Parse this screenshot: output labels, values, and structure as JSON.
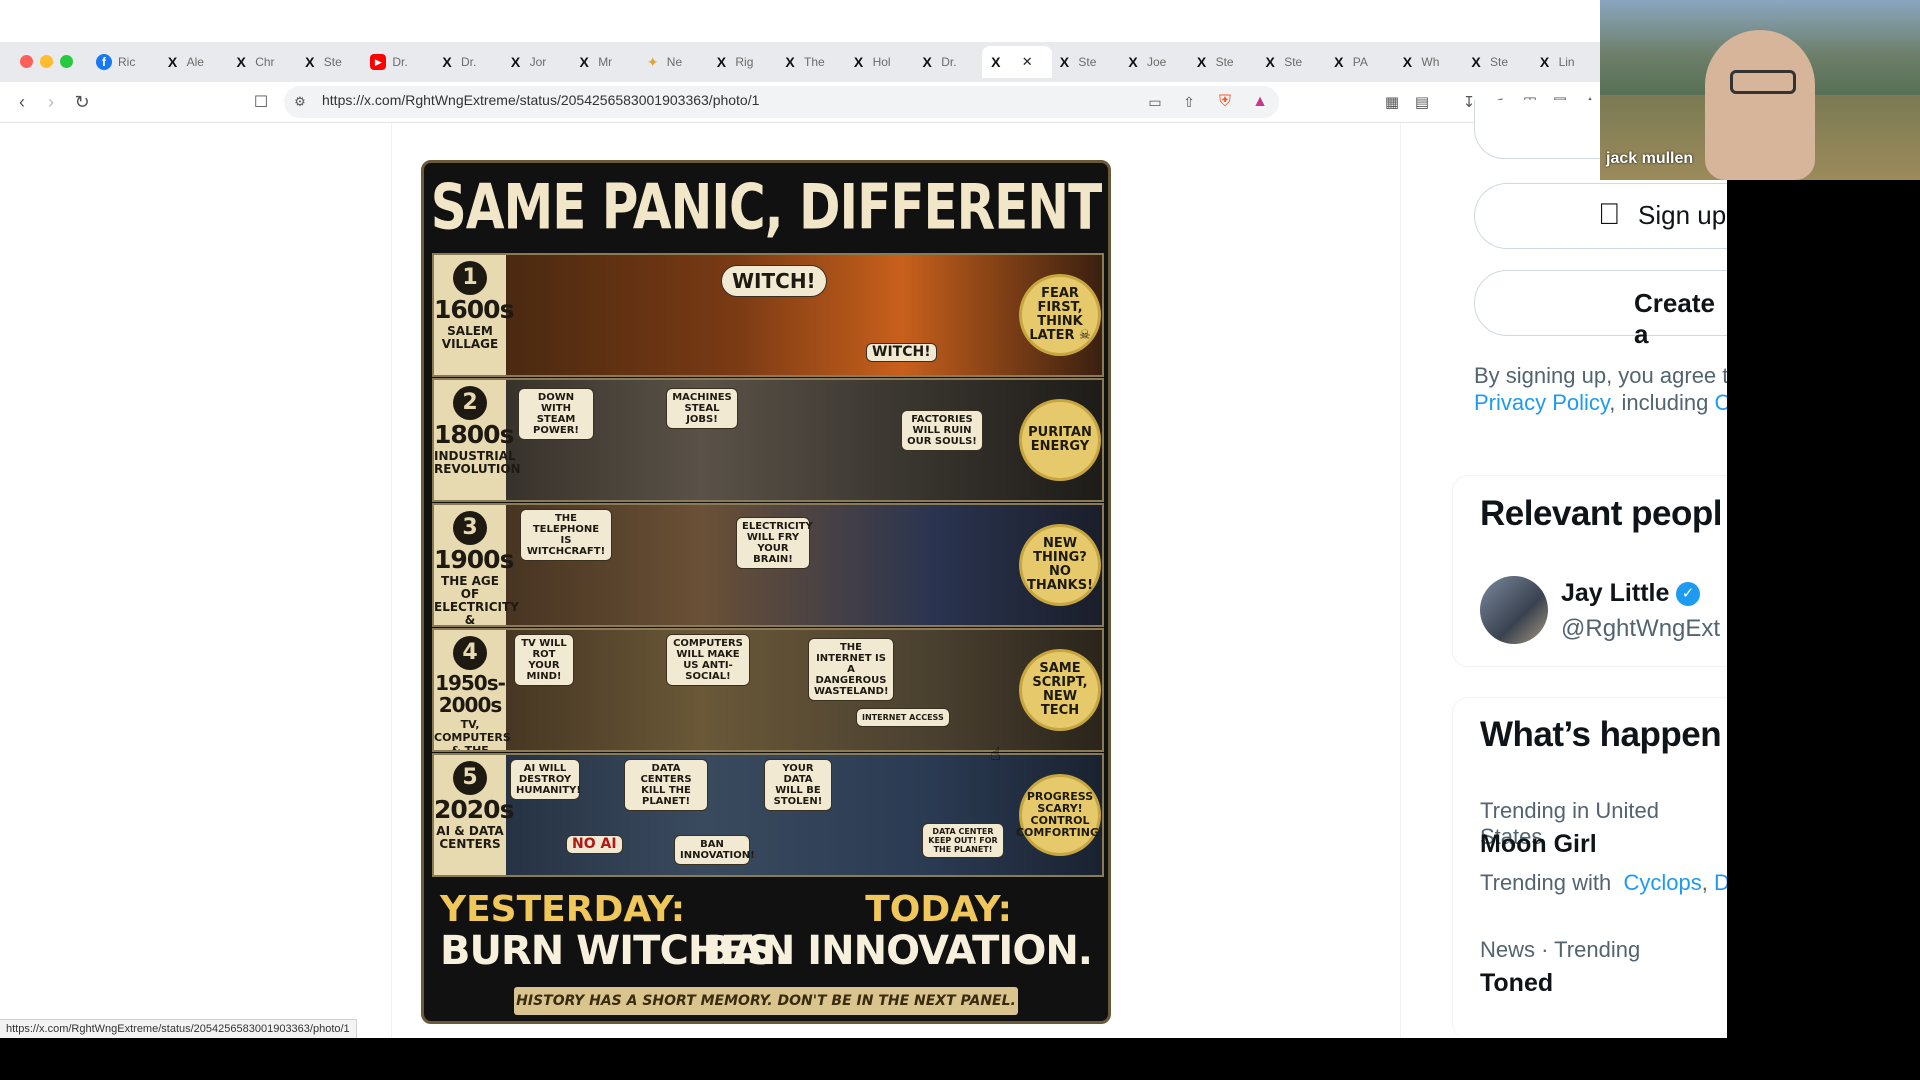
{
  "browser": {
    "tabs": [
      {
        "icon": "facebook-icon",
        "glyph": "f",
        "label": "Ric"
      },
      {
        "icon": "x-logo-icon",
        "glyph": "X",
        "label": "Ale"
      },
      {
        "icon": "x-logo-icon",
        "glyph": "X",
        "label": "Chr"
      },
      {
        "icon": "x-logo-icon",
        "glyph": "X",
        "label": "Ste"
      },
      {
        "icon": "youtube-icon",
        "glyph": "▶",
        "label": "Dr."
      },
      {
        "icon": "x-logo-icon",
        "glyph": "X",
        "label": "Dr."
      },
      {
        "icon": "x-logo-icon",
        "glyph": "X",
        "label": "Jor"
      },
      {
        "icon": "x-logo-icon",
        "glyph": "X",
        "label": "Mr"
      },
      {
        "icon": "bookmark-favicon-icon",
        "glyph": "✦",
        "label": "Ne"
      },
      {
        "icon": "x-logo-icon",
        "glyph": "X",
        "label": "Rig"
      },
      {
        "icon": "x-logo-icon",
        "glyph": "X",
        "label": "The"
      },
      {
        "icon": "x-logo-icon",
        "glyph": "X",
        "label": "Hol"
      },
      {
        "icon": "x-logo-icon",
        "glyph": "X",
        "label": "Dr."
      },
      {
        "icon": "x-logo-icon",
        "glyph": "X",
        "label": "",
        "active": true
      },
      {
        "icon": "x-logo-icon",
        "glyph": "X",
        "label": "Ste"
      },
      {
        "icon": "x-logo-icon",
        "glyph": "X",
        "label": "Joe"
      },
      {
        "icon": "x-logo-icon",
        "glyph": "X",
        "label": "Ste"
      },
      {
        "icon": "x-logo-icon",
        "glyph": "X",
        "label": "Ste"
      },
      {
        "icon": "x-logo-icon",
        "glyph": "X",
        "label": "PA"
      },
      {
        "icon": "x-logo-icon",
        "glyph": "X",
        "label": "Wh"
      },
      {
        "icon": "x-logo-icon",
        "glyph": "X",
        "label": "Ste"
      },
      {
        "icon": "x-logo-icon",
        "glyph": "X",
        "label": "Lin"
      }
    ],
    "url": "https://x.com/RghtWngExtreme/status/2054256583001903363/photo/1",
    "status_url": "https://x.com/RghtWngExtreme/status/2054256583001903363/photo/1"
  },
  "poster": {
    "title": "SAME PANIC, DIFFERENT CENTURY",
    "panels": [
      {
        "num": "1",
        "year": "1600s",
        "sub": "SALEM VILLAGE",
        "badge": "FEAR FIRST, THINK LATER ☠",
        "bubbles": [
          "WITCH!",
          "WITCH!"
        ]
      },
      {
        "num": "2",
        "year": "1800s",
        "sub": "INDUSTRIAL REVOLUTION",
        "badge": "PURITAN ENERGY",
        "bubbles": [
          "DOWN WITH STEAM POWER!",
          "MACHINES STEAL JOBS!",
          "FACTORIES WILL RUIN OUR SOULS!"
        ]
      },
      {
        "num": "3",
        "year": "1900s",
        "sub": "THE AGE OF ELECTRICITY & TELEPHONES",
        "badge": "NEW THING? NO THANKS!",
        "bubbles": [
          "THE TELEPHONE IS WITCHCRAFT!",
          "ELECTRICITY WILL FRY YOUR BRAIN!"
        ]
      },
      {
        "num": "4",
        "year": "1950s-2000s",
        "sub": "TV, COMPUTERS & THE INTERNET",
        "badge": "SAME SCRIPT, NEW TECH",
        "bubbles": [
          "TV WILL ROT YOUR MIND!",
          "COMPUTERS WILL MAKE US ANTI-SOCIAL!",
          "THE INTERNET IS A DANGEROUS WASTELAND!",
          "INTERNET ACCESS"
        ]
      },
      {
        "num": "5",
        "year": "2020s",
        "sub": "AI & DATA CENTERS",
        "badge": "PROGRESS SCARY! CONTROL COMFORTING!",
        "bubbles": [
          "AI WILL DESTROY HUMANITY!",
          "DATA CENTERS KILL THE PLANET!",
          "YOUR DATA WILL BE STOLEN!",
          "NO AI",
          "BAN INNOVATION!",
          "DATA CENTER KEEP OUT! FOR THE PLANET!"
        ]
      }
    ],
    "yesterday_label": "YESTERDAY:",
    "yesterday_text": "BURN WITCHES.",
    "today_label": "TODAY:",
    "today_text": "BAN INNOVATION.",
    "ribbon": "HISTORY HAS A SHORT MEMORY. DON'T BE IN THE NEXT PANEL."
  },
  "sidebar": {
    "signup_apple": "Sign up",
    "create_account": "Create a",
    "terms_line1": "By signing up, you agree t",
    "privacy_policy": "Privacy Policy",
    "terms_including": ", including",
    "terms_cut": "C",
    "relevant_heading": "Relevant peopl",
    "person_name": "Jay Little",
    "person_handle": "@RghtWngExt",
    "whats_heading": "What’s happen",
    "trend1_context": "Trending in United States",
    "trend1_name": "Moon Girl",
    "trend1_with": "Trending with",
    "trend1_link1": "Cyclops",
    "trend1_sep": ",",
    "trend1_link2": "D",
    "trend2_context": "News · Trending",
    "trend2_name": "Toned"
  },
  "webcam": {
    "name": "jack mullen"
  },
  "colors": {
    "x_blue": "#1d9bf0",
    "poster_gold": "#f0c75a"
  }
}
